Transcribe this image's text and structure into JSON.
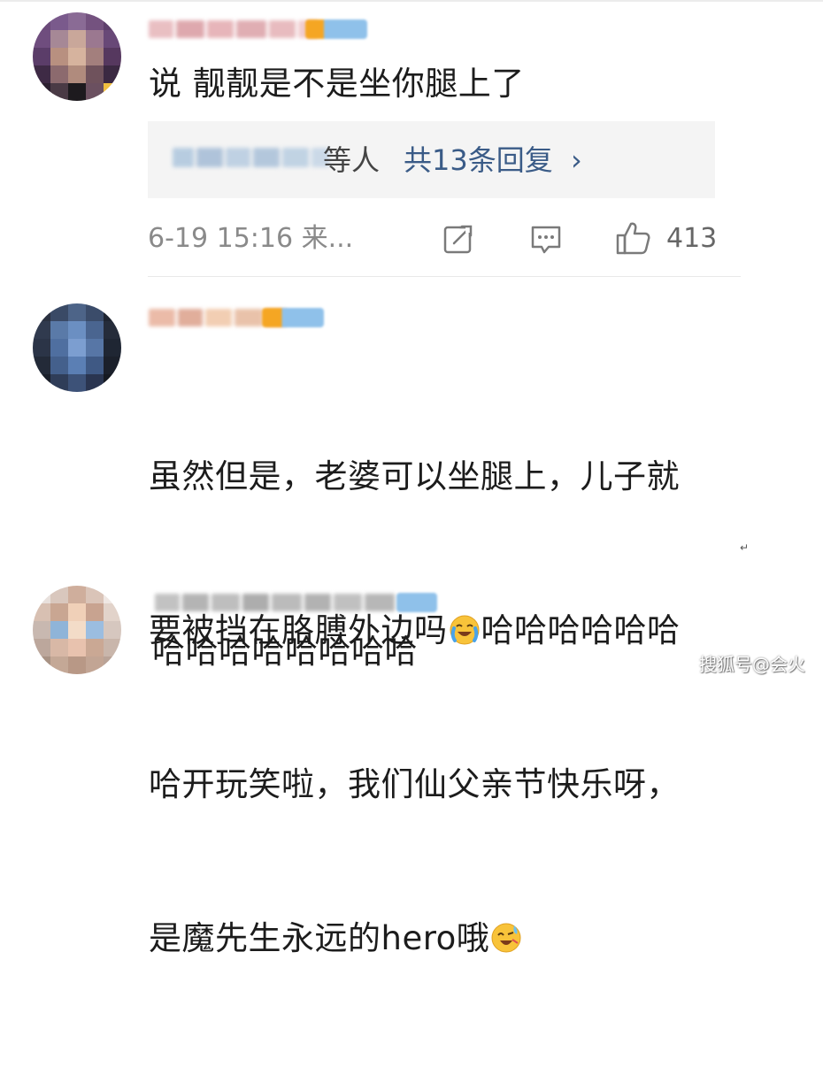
{
  "comments": [
    {
      "text": "说 靓靓是不是坐你腿上了",
      "reply_box": {
        "suffix": "等人",
        "count_label": "共13条回复",
        "chevron": "›"
      },
      "meta": {
        "time": "6-19 15:16 来...",
        "icons": [
          "share-icon",
          "comment-icon",
          "like-icon"
        ],
        "like_count": "413"
      }
    },
    {
      "lines": [
        "虽然但是，老婆可以坐腿上，儿子就",
        "要被挡在胳膊外边吗",
        "哈哈哈哈哈哈",
        "哈开玩笑啦，我们仙父亲节快乐呀，",
        "是魔先生永远的hero哦"
      ],
      "emoji": [
        "crying-laughing-emoji",
        "sweat-laughing-emoji"
      ]
    },
    {
      "text": "哈哈哈哈哈哈哈哈"
    }
  ],
  "watermark": "搜狐号@会火",
  "colors": {
    "link": "#3a5b87",
    "meta_text": "#8a8a8a",
    "reply_bg": "#f4f4f4",
    "vip_orange": "#f5a623",
    "vip_blue": "#8fc1ea"
  }
}
